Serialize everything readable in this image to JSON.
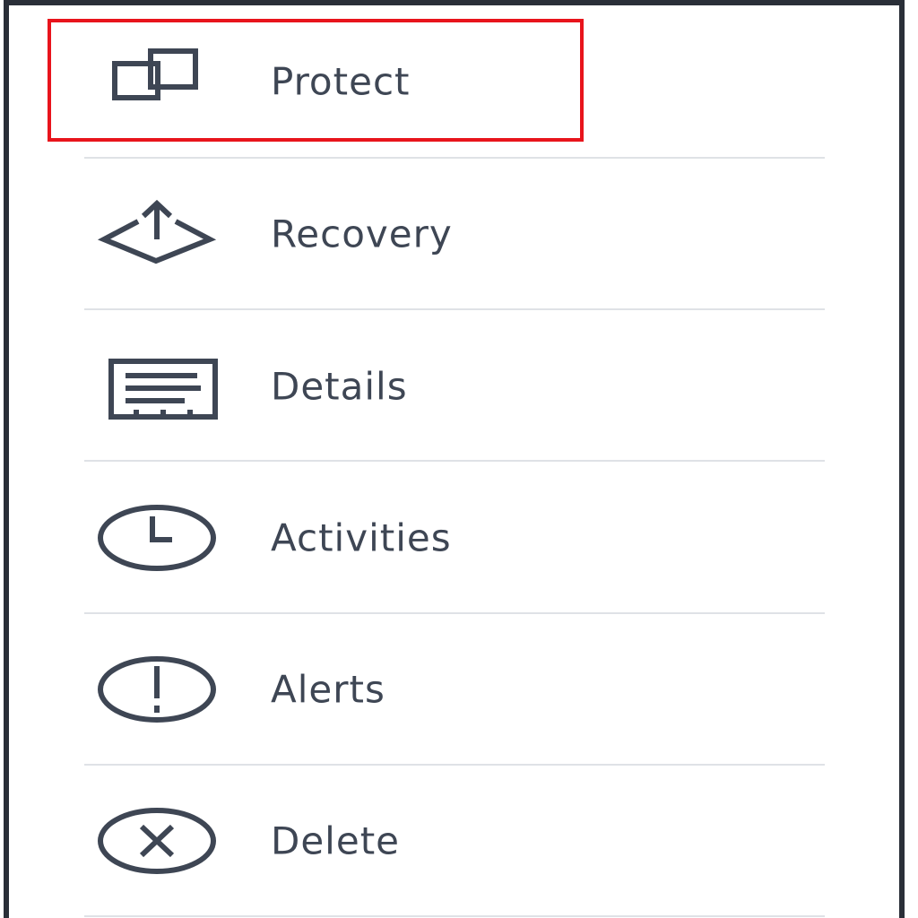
{
  "menu": {
    "items": [
      {
        "label": "Protect",
        "icon": "overlapping-squares-icon"
      },
      {
        "label": "Recovery",
        "icon": "upload-arrow-diamond-icon"
      },
      {
        "label": "Details",
        "icon": "document-details-icon"
      },
      {
        "label": "Activities",
        "icon": "clock-icon"
      },
      {
        "label": "Alerts",
        "icon": "exclamation-circle-icon"
      },
      {
        "label": "Delete",
        "icon": "x-circle-icon"
      }
    ],
    "selected": "Protect"
  },
  "colors": {
    "icon_stroke": "#3e4654",
    "text": "#3e4654",
    "divider": "#dfe2e6",
    "border": "#2a2f38",
    "highlight": "#e8141c"
  }
}
